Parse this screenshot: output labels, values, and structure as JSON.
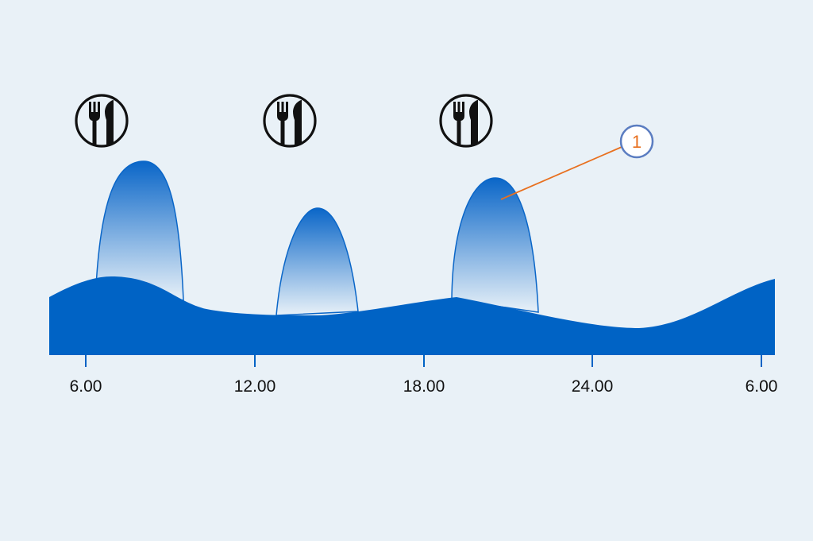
{
  "colors": {
    "background": "#e9f1f7",
    "base_fill": "#0063c5",
    "peak_top": "#0a66c8",
    "peak_bottom": "#e8f1f8",
    "callout_line": "#e8701f",
    "callout_circle": "#5b7dc1",
    "callout_text": "#e8701f",
    "icon": "#111111"
  },
  "x_axis": {
    "ticks": [
      "6.00",
      "12.00",
      "18.00",
      "24.00",
      "6.00"
    ]
  },
  "meals": [
    {
      "icon": "fork-knife-icon"
    },
    {
      "icon": "fork-knife-icon"
    },
    {
      "icon": "fork-knife-icon"
    }
  ],
  "callout": {
    "label": "1"
  }
}
